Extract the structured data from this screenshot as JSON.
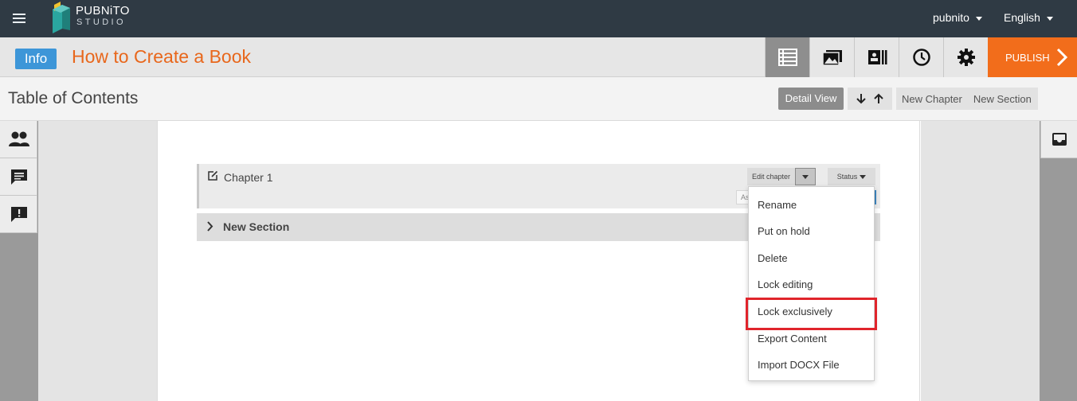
{
  "navbar": {
    "brand_name": "PUBNiTO",
    "brand_sub": "STUDIO",
    "user_menu": "pubnito",
    "language_menu": "English",
    "icons": [
      "hamburger-menu-icon",
      "pubnito-logo"
    ]
  },
  "titlebar": {
    "info_badge": "Info",
    "book_title": "How to Create a Book",
    "tools": [
      "table-of-contents-icon",
      "media-library-icon",
      "book-details-icon",
      "history-clock-icon",
      "settings-gear-icon"
    ],
    "publish_label": "PUBLISH"
  },
  "toc": {
    "title": "Table of Contents",
    "detail_view": "Detail View",
    "new_chapter": "New Chapter",
    "new_section": "New Section",
    "move_icons": [
      "arrow-down-icon",
      "arrow-up-icon"
    ]
  },
  "sidebar_left": {
    "icons": [
      "users-icon",
      "comments-icon",
      "feedback-icon"
    ]
  },
  "sidebar_right": {
    "icons": [
      "inbox-icon"
    ]
  },
  "chapter": {
    "label": "Chapter 1",
    "edit_chapter_label": "Edit chapter",
    "status_label": "Status",
    "assign_chip_text": "As"
  },
  "section": {
    "label": "New Section"
  },
  "chapter_menu": {
    "items": [
      "Rename",
      "Put on hold",
      "Delete",
      "Lock editing",
      "Lock exclusively",
      "Export Content",
      "Import DOCX File"
    ],
    "highlighted": "Lock exclusively"
  },
  "colors": {
    "navbar_bg": "#2f3a44",
    "accent_orange": "#f26d1b",
    "title_orange": "#e8671c",
    "info_blue": "#3d96d8",
    "highlight_red": "#e0242b"
  }
}
